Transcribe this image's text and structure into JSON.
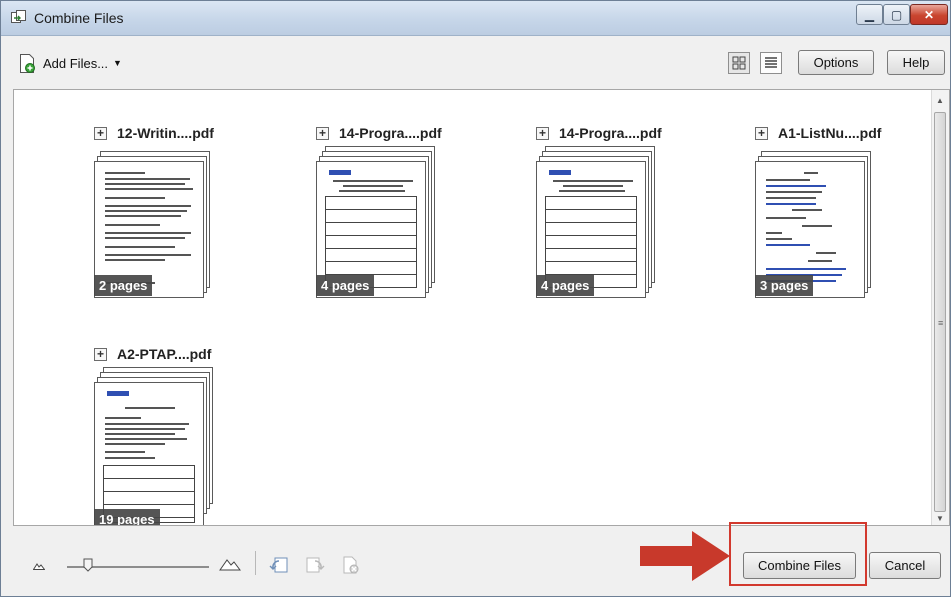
{
  "window": {
    "title": "Combine Files"
  },
  "toolbar": {
    "add_files_label": "Add Files...",
    "options_label": "Options",
    "help_label": "Help"
  },
  "files": [
    {
      "name": "12-Writin....pdf",
      "pages": "2 pages"
    },
    {
      "name": "14-Progra....pdf",
      "pages": "4 pages"
    },
    {
      "name": "14-Progra....pdf",
      "pages": "4 pages"
    },
    {
      "name": "A1-ListNu....pdf",
      "pages": "3 pages"
    },
    {
      "name": "A2-PTAP....pdf",
      "pages": "19 pages"
    }
  ],
  "footer": {
    "combine_label": "Combine Files",
    "cancel_label": "Cancel"
  },
  "colors": {
    "highlight": "#d2392e",
    "arrow": "#c8392b"
  }
}
